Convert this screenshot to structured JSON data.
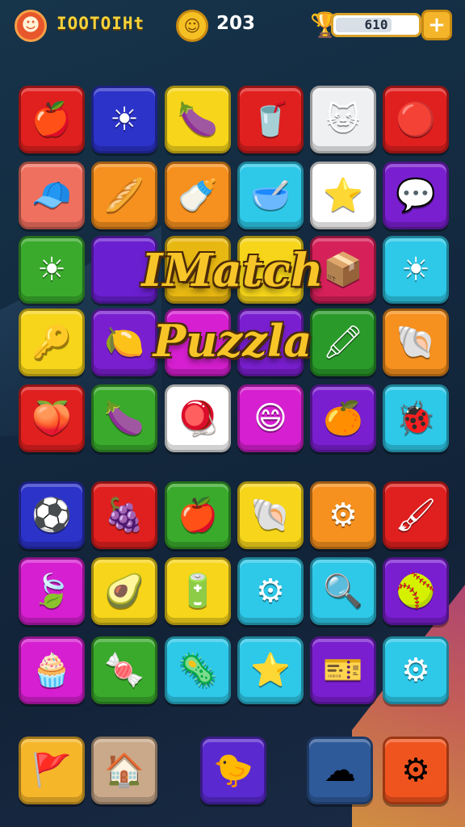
{
  "hud": {
    "player_name": "IOOTOIHt",
    "score": "203",
    "energy_value": "610",
    "energy_fill": 0.65,
    "icons": {
      "profile": "profile-badge-icon",
      "coin": "coin-icon",
      "trophy": "trophy-icon",
      "add": "plus-icon"
    }
  },
  "title": {
    "line1": "IMatch",
    "line2": "Puzzla"
  },
  "board": {
    "rows": [
      [
        {
          "item": "apple",
          "glyph": "🍎",
          "color": "#e0201f"
        },
        {
          "item": "sun",
          "glyph": "☀",
          "color": "#2b33c8"
        },
        {
          "item": "eggplant",
          "glyph": "🍆",
          "color": "#f6d51a"
        },
        {
          "item": "cup",
          "glyph": "🥤",
          "color": "#e0201f"
        },
        {
          "item": "cat",
          "glyph": "🐱",
          "color": "#eef0f2"
        },
        {
          "item": "ball",
          "glyph": "🔴",
          "color": "#e0201f"
        }
      ],
      [
        {
          "item": "cap",
          "glyph": "🧢",
          "color": "#f07060"
        },
        {
          "item": "stick",
          "glyph": "🥖",
          "color": "#f6901e"
        },
        {
          "item": "bottle",
          "glyph": "🍼",
          "color": "#f6901e"
        },
        {
          "item": "bowl",
          "glyph": "🥣",
          "color": "#2ec8e8"
        },
        {
          "item": "star",
          "glyph": "⭐",
          "color": "#ffffff"
        },
        {
          "item": "blob",
          "glyph": "💬",
          "color": "#7a1fd0"
        }
      ],
      [
        {
          "item": "sun",
          "glyph": "☀",
          "color": "#3aaa2c"
        },
        {
          "item": "hidden",
          "glyph": "",
          "color": "#6a1fd0"
        },
        {
          "item": "hidden",
          "glyph": "",
          "color": "#e8b812"
        },
        {
          "item": "hidden",
          "glyph": "",
          "color": "#f6d51a"
        },
        {
          "item": "crate",
          "glyph": "📦",
          "color": "#d6205a"
        },
        {
          "item": "sun",
          "glyph": "☀",
          "color": "#2ec8e8"
        }
      ],
      [
        {
          "item": "key",
          "glyph": "🔑",
          "color": "#f6d51a"
        },
        {
          "item": "lemon",
          "glyph": "🍋",
          "color": "#7a1fd0"
        },
        {
          "item": "hidden",
          "glyph": "",
          "color": "#d61fd0"
        },
        {
          "item": "hidden",
          "glyph": "",
          "color": "#7a1fd0"
        },
        {
          "item": "pencil",
          "glyph": "🖍",
          "color": "#2a9a2a"
        },
        {
          "item": "shell",
          "glyph": "🐚",
          "color": "#f6901e"
        }
      ],
      [
        {
          "item": "plum",
          "glyph": "🍑",
          "color": "#e0201f"
        },
        {
          "item": "eggplant",
          "glyph": "🍆",
          "color": "#3aaa2c"
        },
        {
          "item": "top",
          "glyph": "🪀",
          "color": "#ffffff"
        },
        {
          "item": "monster",
          "glyph": "😄",
          "color": "#d61fd0"
        },
        {
          "item": "orange",
          "glyph": "🍊",
          "color": "#7a1fd0"
        },
        {
          "item": "bug",
          "glyph": "🐞",
          "color": "#2ec8e8"
        }
      ],
      [
        {
          "item": "ball",
          "glyph": "⚽",
          "color": "#2b33c8"
        },
        {
          "item": "plum",
          "glyph": "🍇",
          "color": "#e0201f"
        },
        {
          "item": "apple",
          "glyph": "🍎",
          "color": "#3aaa2c"
        },
        {
          "item": "shell",
          "glyph": "🐚",
          "color": "#f6d51a"
        },
        {
          "item": "gear",
          "glyph": "⚙",
          "color": "#f6901e"
        },
        {
          "item": "brush",
          "glyph": "🖌",
          "color": "#e0201f"
        }
      ],
      [
        {
          "item": "leaf",
          "glyph": "🍃",
          "color": "#d61fd0"
        },
        {
          "item": "lime",
          "glyph": "🥑",
          "color": "#f6d51a"
        },
        {
          "item": "battery",
          "glyph": "🔋",
          "color": "#f6d51a"
        },
        {
          "item": "gear",
          "glyph": "⚙",
          "color": "#2ec8e8"
        },
        {
          "item": "lens",
          "glyph": "🔍",
          "color": "#2ec8e8"
        },
        {
          "item": "dome",
          "glyph": "🥎",
          "color": "#7a1fd0"
        }
      ],
      [
        {
          "item": "jelly",
          "glyph": "🧁",
          "color": "#d61fd0"
        },
        {
          "item": "candy",
          "glyph": "🍬",
          "color": "#3aaa2c"
        },
        {
          "item": "virus",
          "glyph": "🦠",
          "color": "#2ec8e8"
        },
        {
          "item": "star",
          "glyph": "⭐",
          "color": "#2ec8e8"
        },
        {
          "item": "ticket",
          "glyph": "🎫",
          "color": "#7a1fd0"
        },
        {
          "item": "gear",
          "glyph": "⚙",
          "color": "#2ec8e8"
        }
      ]
    ]
  },
  "bottom_bar": [
    {
      "name": "flag-button",
      "glyph": "🚩",
      "color": "#f6b62a"
    },
    {
      "name": "home-button",
      "glyph": "🏠",
      "color": "#c9a98a"
    },
    {
      "name": "character-button",
      "glyph": "🐤",
      "color": "#5a2ad0"
    },
    {
      "name": "cloud-button",
      "glyph": "☁",
      "color": "#2f5a9a"
    },
    {
      "name": "settings-button",
      "glyph": "⚙",
      "color": "#f0541e"
    }
  ]
}
